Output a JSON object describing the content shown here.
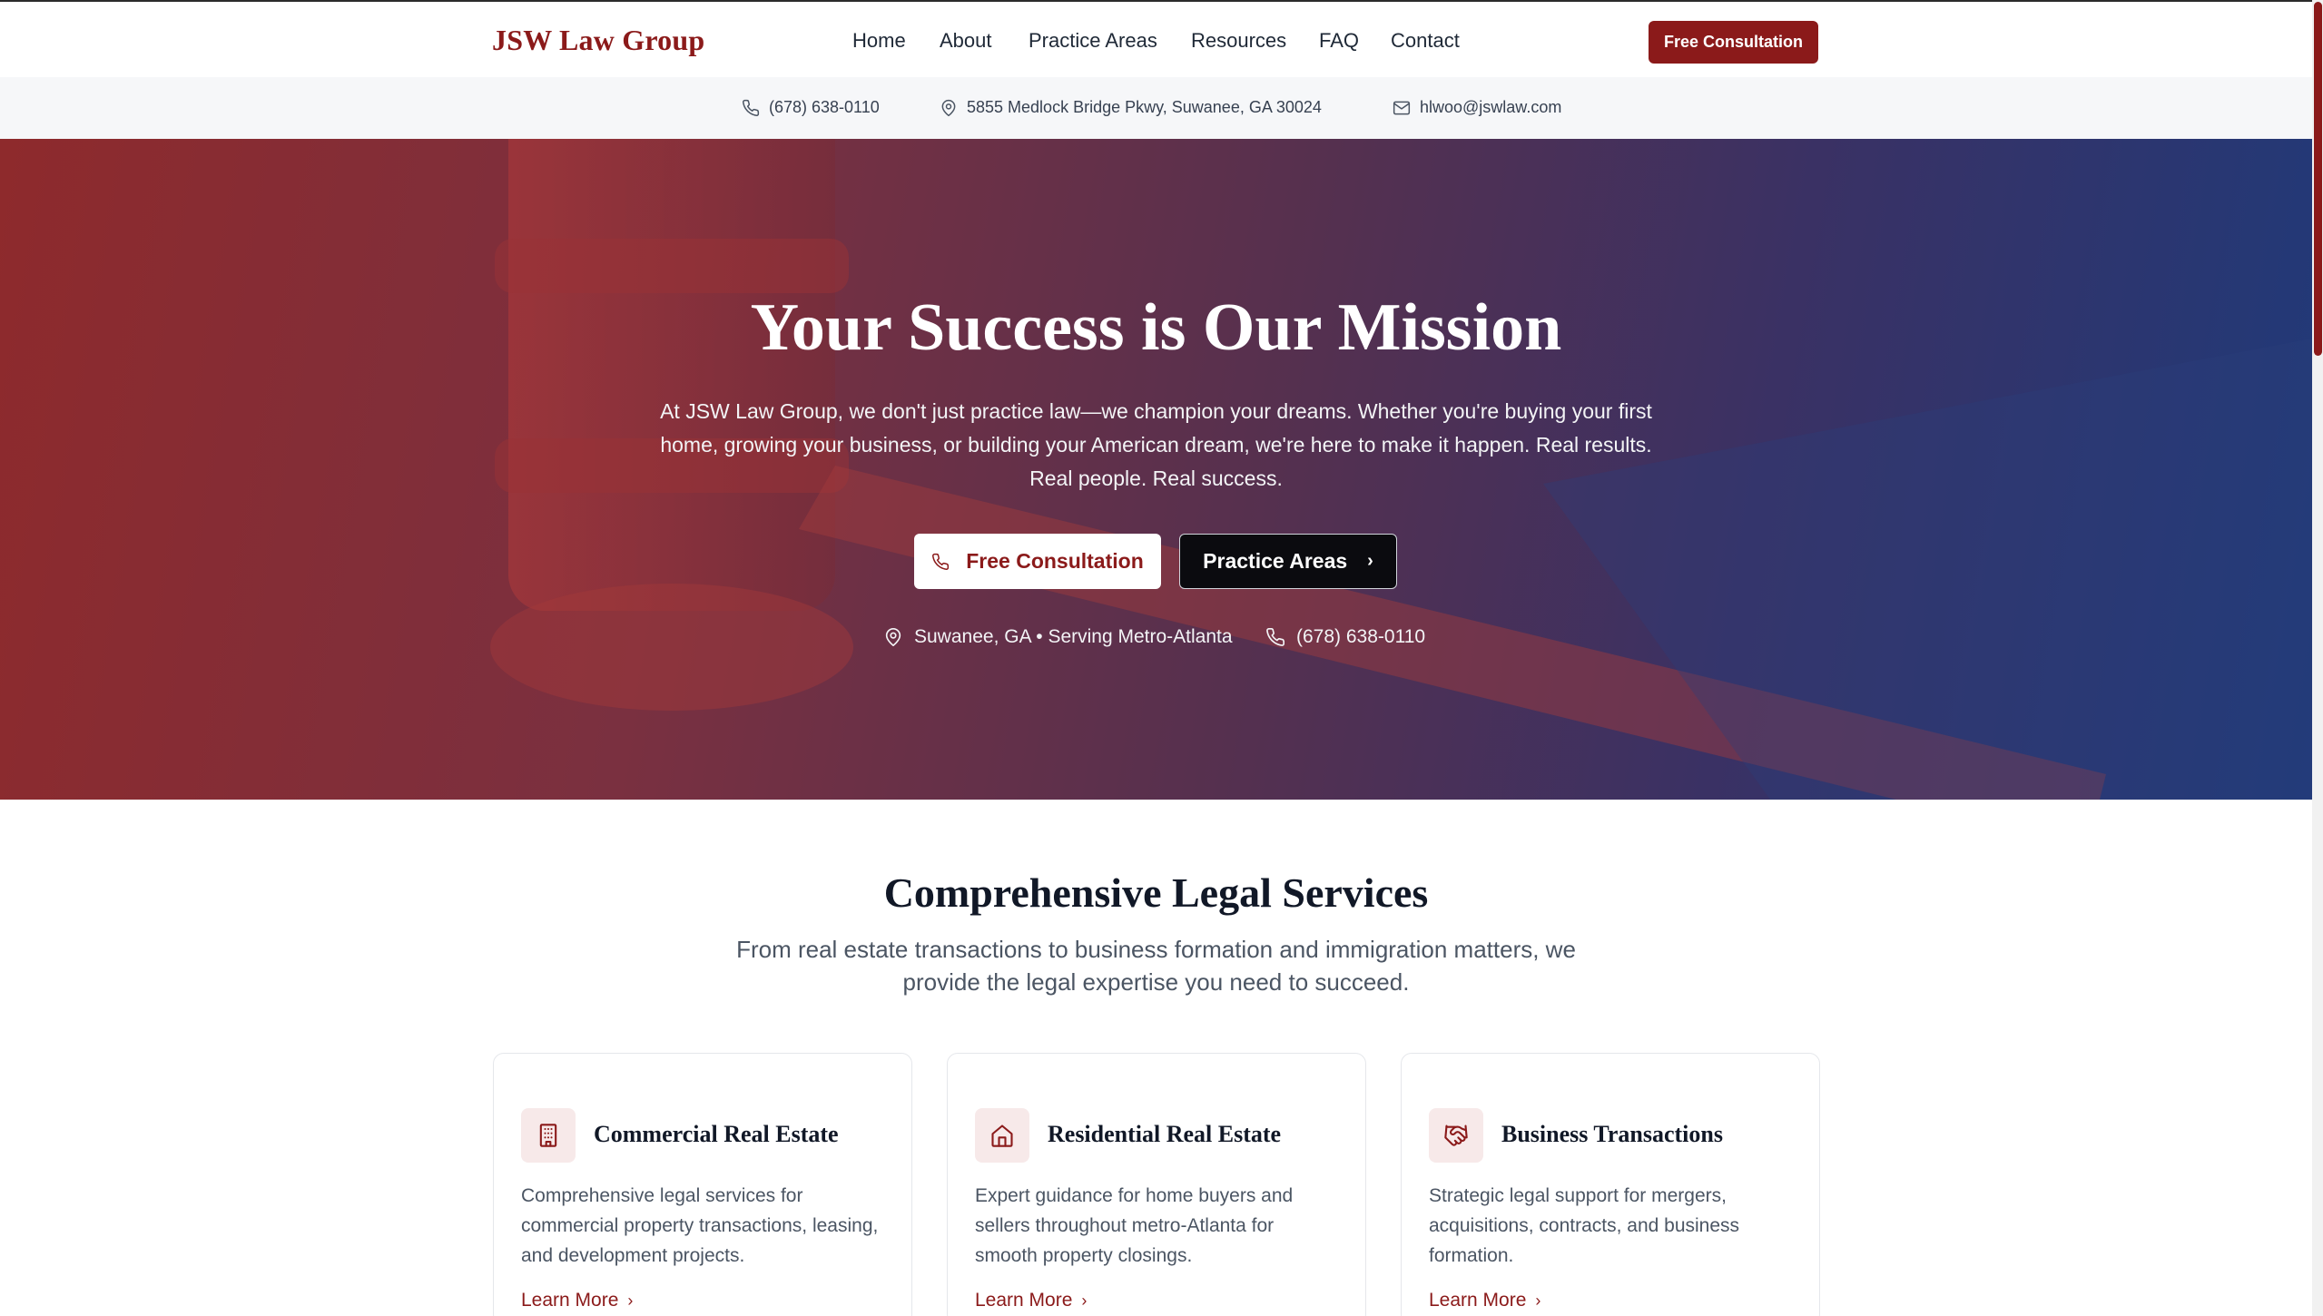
{
  "nav": {
    "logo": "JSW Law Group",
    "items": [
      "Home",
      "About",
      "Practice Areas",
      "Resources",
      "FAQ",
      "Contact"
    ],
    "cta": "Free Consultation"
  },
  "infobar": {
    "phone": "(678) 638-0110",
    "address": "5855 Medlock Bridge Pkwy, Suwanee, GA 30024",
    "email": "hlwoo@jswlaw.com"
  },
  "hero": {
    "title": "Your Success is Our Mission",
    "subtitle": "At JSW Law Group, we don't just practice law—we champion your dreams. Whether you're buying your first home, growing your business, or building your American dream, we're here to make it happen. Real results. Real people. Real success.",
    "primary_button": "Free Consultation",
    "secondary_button": "Practice Areas",
    "location": "Suwanee, GA • Serving Metro-Atlanta",
    "phone": "(678) 638-0110"
  },
  "services": {
    "title": "Comprehensive Legal Services",
    "subtitle": "From real estate transactions to business formation and immigration matters, we provide the legal expertise you need to succeed.",
    "cards": [
      {
        "icon": "building-icon",
        "title": "Commercial Real Estate",
        "description": "Comprehensive legal services for commercial property transactions, leasing, and development projects.",
        "link": "Learn More"
      },
      {
        "icon": "home-icon",
        "title": "Residential Real Estate",
        "description": "Expert guidance for home buyers and sellers throughout metro-Atlanta for smooth property closings.",
        "link": "Learn More"
      },
      {
        "icon": "handshake-icon",
        "title": "Business Transactions",
        "description": "Strategic legal support for mergers, acquisitions, contracts, and business formation.",
        "link": "Learn More"
      }
    ]
  },
  "colors": {
    "brand": "#8b1a1a",
    "hero_gradient_start": "#8e2a2c",
    "hero_gradient_end": "#1f3a7a"
  }
}
